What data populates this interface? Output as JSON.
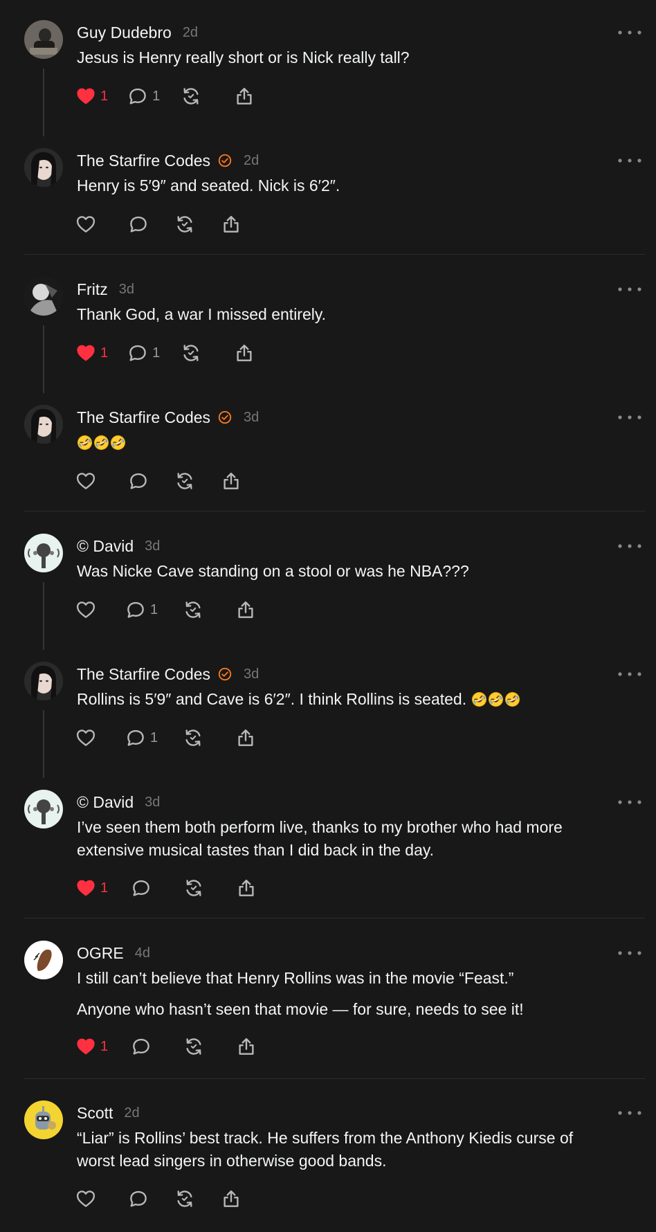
{
  "posts": [
    {
      "author": "Guy Dudebro",
      "time": "2d",
      "text": "Jesus is Henry really short or is Nick really tall?",
      "likes": "1",
      "replies": "1"
    },
    {
      "author": "The Starfire Codes",
      "time": "2d",
      "text": "Henry is 5′9″ and seated. Nick is 6′2″."
    },
    {
      "author": "Fritz",
      "time": "3d",
      "text": "Thank God, a war I missed entirely.",
      "likes": "1",
      "replies": "1"
    },
    {
      "author": "The Starfire Codes",
      "time": "3d",
      "emoji_alt": "🤣🤣🤣"
    },
    {
      "author": "© David",
      "time": "3d",
      "text": "Was Nicke Cave standing on a stool or was he NBA???",
      "replies": "1"
    },
    {
      "author": "The Starfire Codes",
      "time": "3d",
      "text": "Rollins is 5′9″ and Cave is 6′2″. I think Rollins is seated.",
      "emoji_alt": "🤣🤣🤣",
      "replies": "1"
    },
    {
      "author": "© David",
      "time": "3d",
      "text_line1": "I’ve seen them both perform live, thanks to my brother who had more",
      "text_line2": "extensive musical tastes than I did back in the day.",
      "likes": "1"
    },
    {
      "author": "OGRE",
      "time": "4d",
      "paragraph1": "I still can’t believe that Henry Rollins was in the movie “Feast.”",
      "paragraph2": "Anyone who hasn’t seen that movie — for sure, needs to see it!",
      "likes": "1"
    },
    {
      "author": "Scott",
      "time": "2d",
      "text_line1": "“Liar” is Rollins’ best track. He suffers from the Anthony Kiedis curse of",
      "text_line2": "worst lead singers in otherwise good bands."
    }
  ],
  "colors": {
    "background": "#181818",
    "text": "#f3f5f7",
    "muted": "#777777",
    "like": "#ff3040",
    "verified": "#ff7a1a",
    "divider": "#2c2c2e"
  },
  "icons": [
    "more-icon",
    "heart-icon",
    "comment-icon",
    "repost-icon",
    "share-icon",
    "verified-badge-icon"
  ]
}
